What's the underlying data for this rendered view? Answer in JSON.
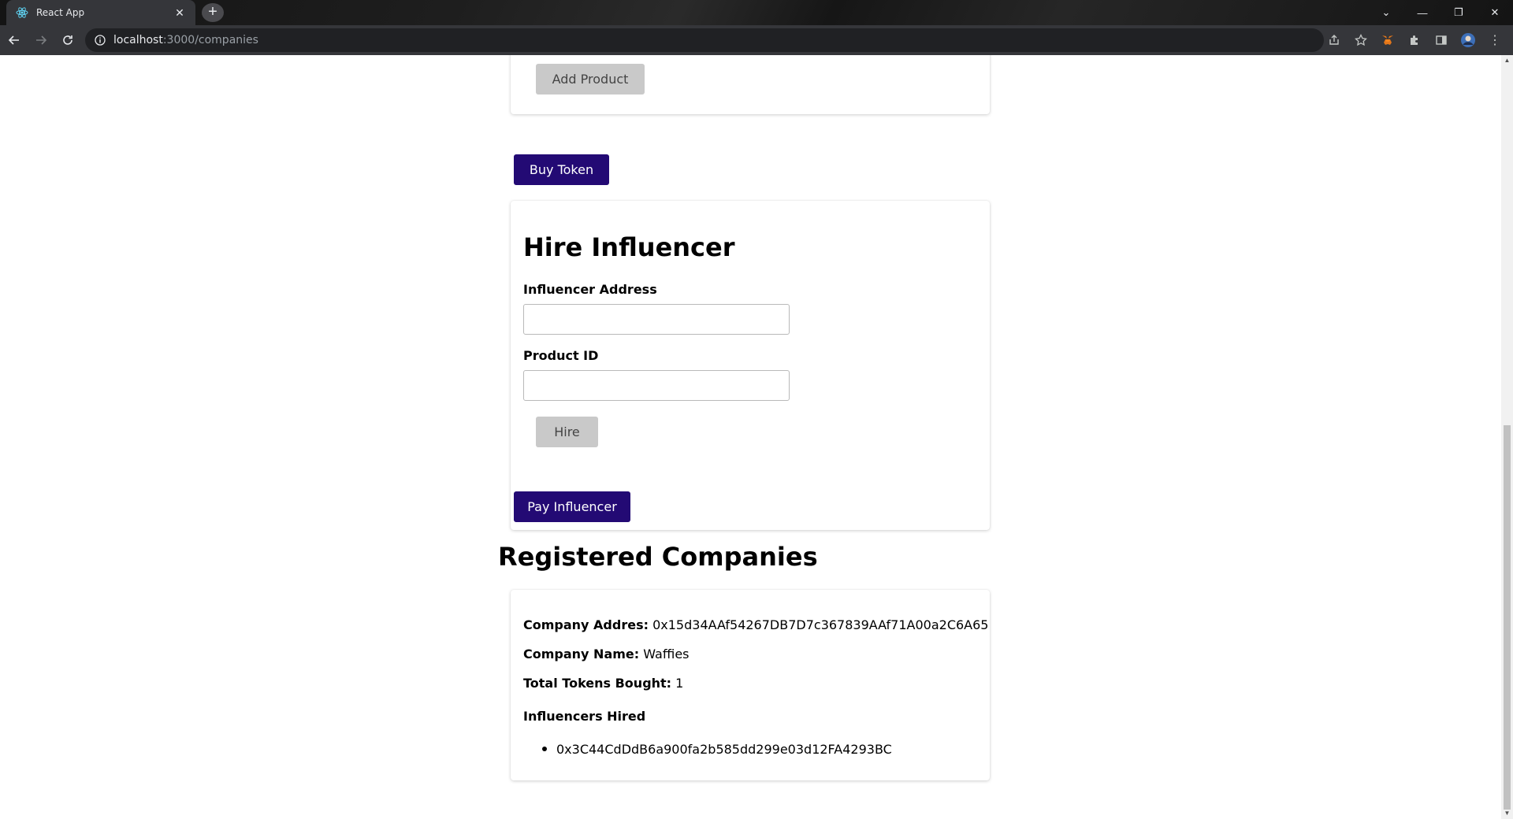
{
  "browser": {
    "tab_title": "React App",
    "url_host": "localhost",
    "url_path": ":3000/companies"
  },
  "product_section": {
    "add_button": "Add Product"
  },
  "buy_token_button": "Buy Token",
  "hire_section": {
    "title": "Hire Influencer",
    "address_label": "Influencer Address",
    "address_value": "",
    "product_label": "Product ID",
    "product_value": "",
    "hire_button": "Hire"
  },
  "pay_button": "Pay Influencer",
  "companies": {
    "title": "Registered Companies",
    "items": [
      {
        "address_label": "Company Addres:",
        "address": "0x15d34AAf54267DB7D7c367839AAf71A00a2C6A65",
        "name_label": "Company Name:",
        "name": "Waffies",
        "tokens_label": "Total Tokens Bought:",
        "tokens": "1",
        "influencers_label": "Influencers Hired",
        "influencers": [
          "0x3C44CdDdB6a900fa2b585dd299e03d12FA4293BC"
        ]
      }
    ]
  },
  "colors": {
    "primary_button": "#230a74",
    "disabled_button": "#c9c9c9"
  }
}
